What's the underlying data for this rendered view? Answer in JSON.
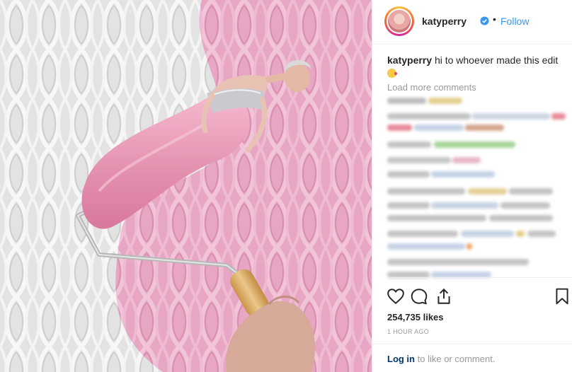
{
  "post": {
    "username": "katyperry",
    "follow_label": "Follow",
    "dot": "•",
    "caption_user": "katyperry",
    "caption_text": "hi to whoever made this edit",
    "load_more": "Load more comments",
    "likes": "254,735 likes",
    "timestamp": "1 HOUR AGO",
    "login_link": "Log in",
    "login_rest": "to like or comment."
  },
  "icons": [
    "heart-icon",
    "comment-icon",
    "share-icon",
    "bookmark-icon",
    "verified-badge-icon"
  ],
  "colors": {
    "accent": "#3897f0",
    "pink_wall": "#e9a9c5",
    "white_wall": "#e4e4e4",
    "roller_handle": "#d9ad6c"
  }
}
